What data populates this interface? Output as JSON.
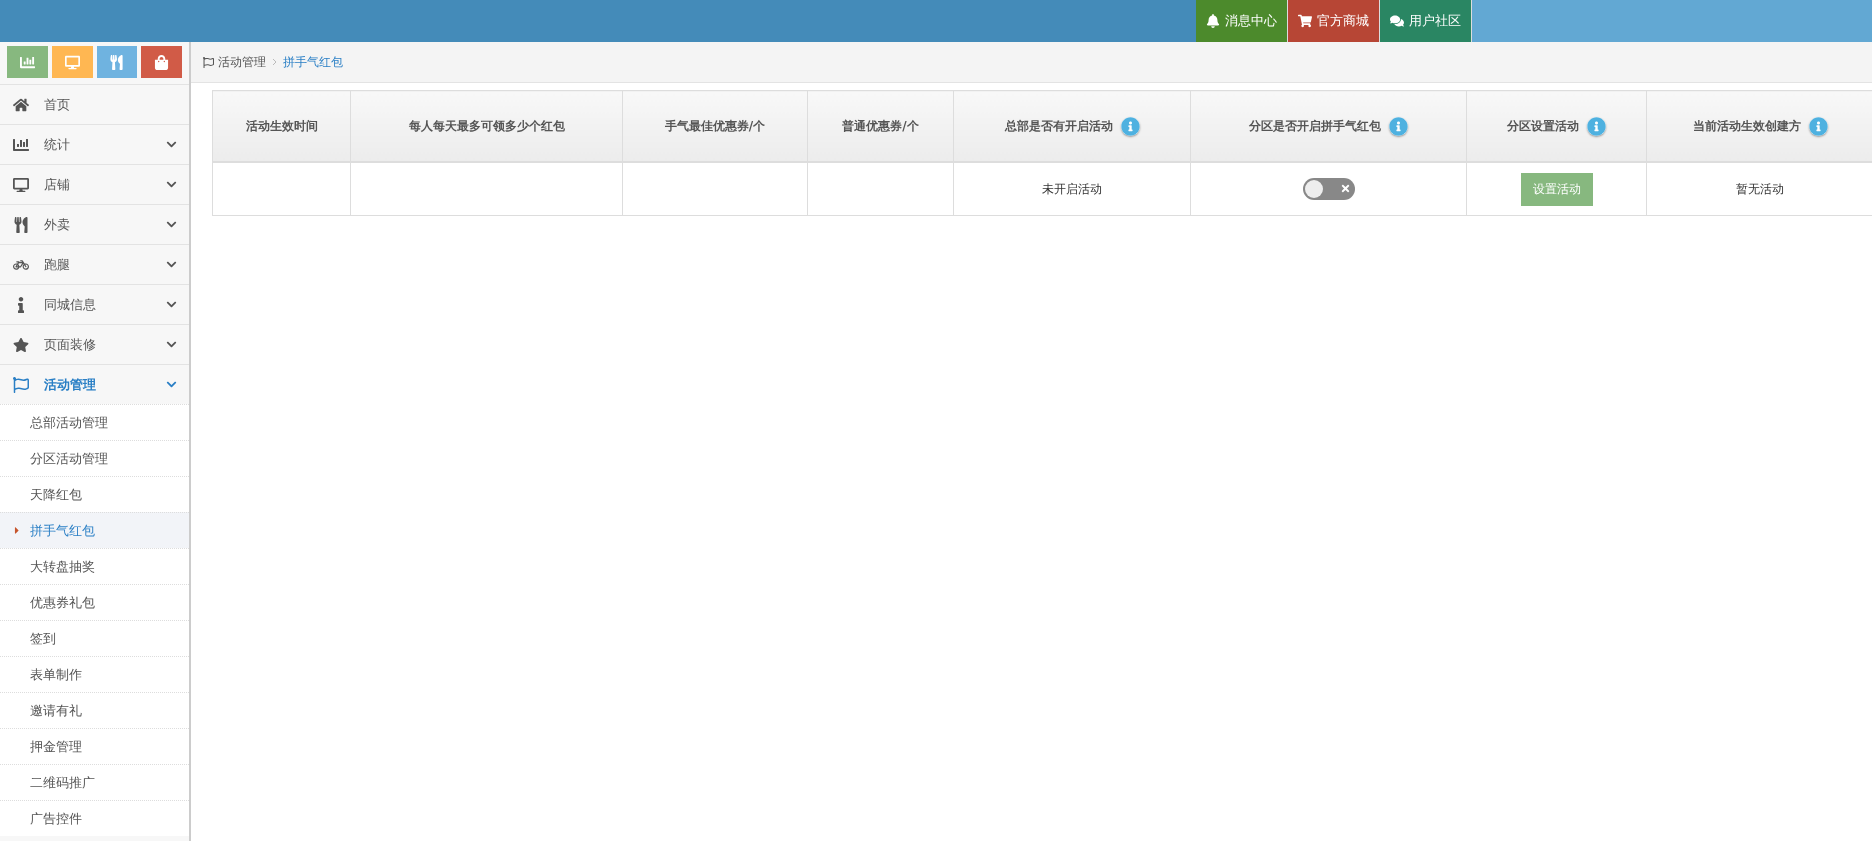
{
  "top_links": [
    {
      "label": "消息中心",
      "kind": "bell"
    },
    {
      "label": "官方商城",
      "kind": "cart"
    },
    {
      "label": "用户社区",
      "kind": "chat"
    }
  ],
  "sidebar": {
    "items": [
      {
        "label": "首页",
        "kind": "link"
      },
      {
        "label": "统计",
        "kind": "menu",
        "expanded": false
      },
      {
        "label": "店铺",
        "kind": "menu",
        "expanded": false
      },
      {
        "label": "外卖",
        "kind": "menu",
        "expanded": false
      },
      {
        "label": "跑腿",
        "kind": "menu",
        "expanded": false
      },
      {
        "label": "同城信息",
        "kind": "menu",
        "expanded": false
      },
      {
        "label": "页面装修",
        "kind": "menu",
        "expanded": false
      },
      {
        "label": "活动管理",
        "kind": "menu",
        "expanded": true,
        "children": [
          {
            "label": "总部活动管理",
            "selected": false
          },
          {
            "label": "分区活动管理",
            "selected": false
          },
          {
            "label": "天降红包",
            "selected": false
          },
          {
            "label": "拼手气红包",
            "selected": true
          },
          {
            "label": "大转盘抽奖",
            "selected": false
          },
          {
            "label": "优惠券礼包",
            "selected": false
          },
          {
            "label": "签到",
            "selected": false
          },
          {
            "label": "表单制作",
            "selected": false
          },
          {
            "label": "邀请有礼",
            "selected": false
          },
          {
            "label": "押金管理",
            "selected": false
          },
          {
            "label": "二维码推广",
            "selected": false
          },
          {
            "label": "广告控件",
            "selected": false
          }
        ]
      }
    ]
  },
  "breadcrumb": [
    "活动管理",
    "拼手气红包"
  ],
  "table": {
    "columns": [
      {
        "label": "活动生效时间",
        "info": false
      },
      {
        "label": "每人每天最多可领多少个红包",
        "info": false
      },
      {
        "label": "手气最佳优惠券/个",
        "info": false
      },
      {
        "label": "普通优惠券/个",
        "info": false
      },
      {
        "label": "总部是否有开启活动",
        "info": true
      },
      {
        "label": "分区是否开启拼手气红包",
        "info": true
      },
      {
        "label": "分区设置活动",
        "info": true
      },
      {
        "label": "当前活动生效创建方",
        "info": true
      }
    ],
    "rows": [
      [
        {
          "kind": "text"
        },
        {
          "kind": "text"
        },
        {
          "kind": "text"
        },
        {
          "kind": "text"
        },
        {
          "kind": "text",
          "text": "未开启活动"
        },
        {
          "kind": "toggle",
          "on": false
        },
        {
          "kind": "button",
          "text": "设置活动"
        },
        {
          "kind": "text",
          "text": "暂无活动"
        }
      ]
    ]
  }
}
